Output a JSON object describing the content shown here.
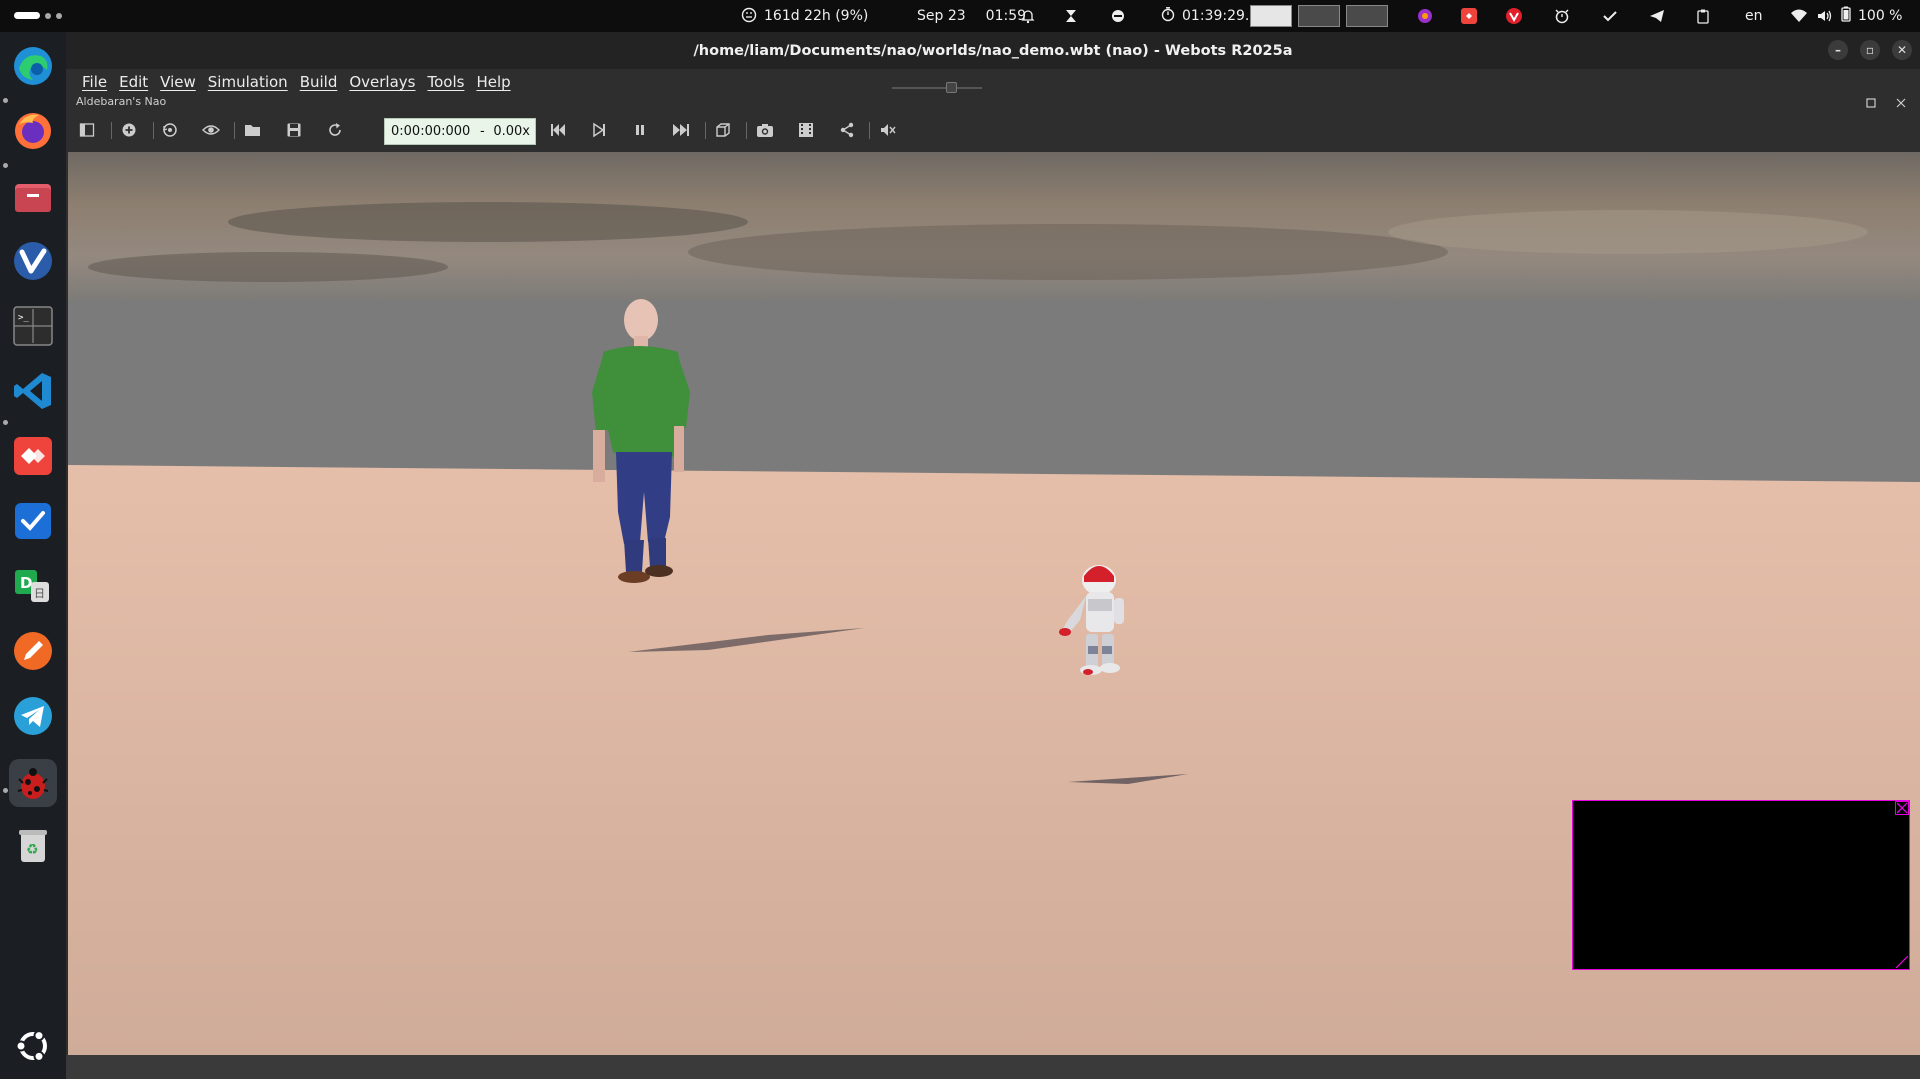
{
  "system_bar": {
    "battery_status": "161d 22h (9%)",
    "date": "Sep 23",
    "time": "01:59",
    "timer": "01:39:29.2",
    "language": "en",
    "battery_percent": "100 %"
  },
  "window": {
    "title": "/home/liam/Documents/nao/worlds/nao_demo.wbt (nao) - Webots R2025a"
  },
  "menu": {
    "items": [
      "File",
      "Edit",
      "View",
      "Simulation",
      "Build",
      "Overlays",
      "Tools",
      "Help"
    ]
  },
  "world_info": "Aldebaran's Nao",
  "toolbar": {
    "time": "0:00:00:000",
    "separator": "-",
    "speed": "0.00x"
  },
  "colors": {
    "overlay_border": "#e000e0",
    "checker_dark": "#7b2e35",
    "checker_light": "#e9c2ae",
    "sky_gray": "#777777"
  },
  "dock_icons": [
    "edge-icon",
    "firefox-icon",
    "files-icon",
    "vivaldi-icon",
    "terminal-icon",
    "vscode-icon",
    "anydesk-icon",
    "todo-icon",
    "dictionary-icon",
    "pencil-icon",
    "telegram-icon",
    "webots-icon",
    "trash-icon",
    "ubuntu-icon"
  ]
}
